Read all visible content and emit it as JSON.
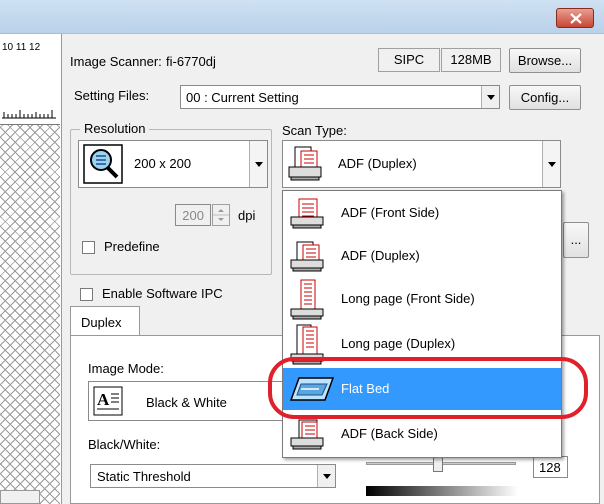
{
  "ruler": {
    "numbers": "10  11  12"
  },
  "scanner": {
    "label": "Image Scanner:",
    "model": "fi-6770dj",
    "sipc": "SIPC",
    "memory": "128MB",
    "browse_label": "Browse..."
  },
  "setting_files": {
    "label": "Setting Files:",
    "value": "00 : Current Setting",
    "config_label": "Config..."
  },
  "resolution": {
    "group_label": "Resolution",
    "value": "200 x 200",
    "custom_value": "200",
    "unit": "dpi",
    "predefine_label": "Predefine"
  },
  "scan_type": {
    "label": "Scan Type:",
    "value": "ADF (Duplex)"
  },
  "software_ipc": {
    "label": "Enable Software IPC"
  },
  "tabs": {
    "duplex": "Duplex"
  },
  "image_mode": {
    "label": "Image Mode:",
    "value": "Black & White"
  },
  "black_white": {
    "label": "Black/White:",
    "value": "Static Threshold"
  },
  "threshold": {
    "value": "128"
  },
  "side_button": {
    "label": "..."
  },
  "dropdown": {
    "items": [
      {
        "label": "ADF (Front Side)",
        "icon": "adf-front-icon"
      },
      {
        "label": "ADF (Duplex)",
        "icon": "adf-duplex-icon"
      },
      {
        "label": "Long page (Front Side)",
        "icon": "long-page-front-icon"
      },
      {
        "label": "Long page (Duplex)",
        "icon": "long-page-duplex-icon"
      },
      {
        "label": "Flat Bed",
        "icon": "flatbed-icon",
        "selected": true
      },
      {
        "label": "ADF (Back Side)",
        "icon": "adf-back-icon"
      }
    ]
  },
  "colors": {
    "selection": "#3399ff",
    "highlight_ring": "#e0202a"
  }
}
